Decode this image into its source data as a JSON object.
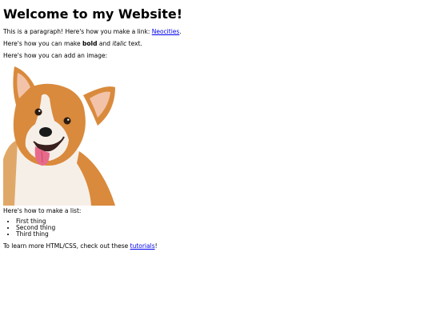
{
  "heading": "Welcome to my Website!",
  "paragraph_link": {
    "before": "This is a paragraph! Here's how you make a link: ",
    "link_text": "Neocities",
    "after": "."
  },
  "paragraph_format": {
    "before": "Here's how you can make ",
    "bold": "bold",
    "middle": " and ",
    "italic": "italic",
    "after": " text."
  },
  "paragraph_image": "Here's how you can add an image:",
  "image": {
    "subject": "corgi dog photo",
    "colors": {
      "fur_orange": "#d98a3c",
      "fur_white": "#f6efe8",
      "nose": "#1a1a1a",
      "tongue": "#e86a8b"
    }
  },
  "paragraph_list": "Here's how to make a list:",
  "list_items": [
    "First thing",
    "Second thing",
    "Third thing"
  ],
  "paragraph_tutorials": {
    "before": "To learn more HTML/CSS, check out these ",
    "link_text": "tutorials",
    "after": "!"
  },
  "colors": {
    "link": "#0000ee",
    "text": "#000000",
    "background": "#ffffff"
  }
}
